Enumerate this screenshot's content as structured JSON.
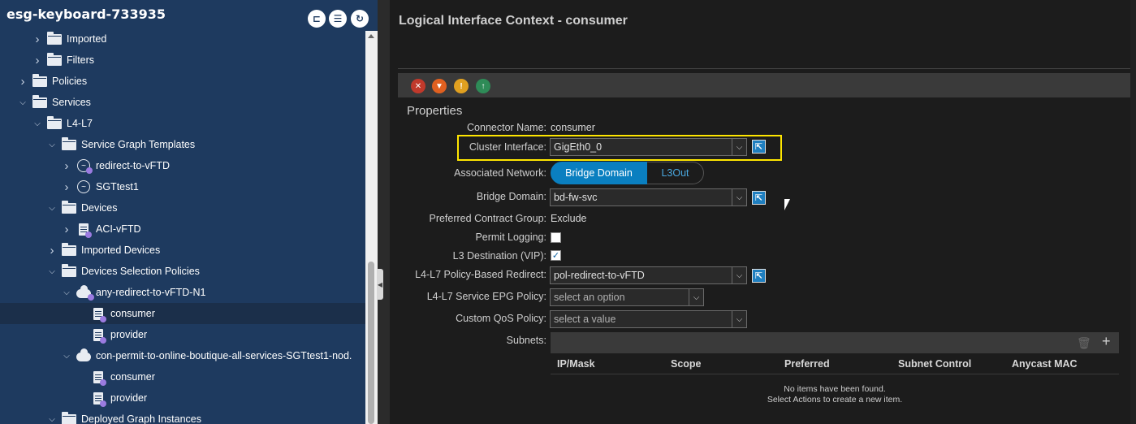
{
  "left_panel": {
    "title": "esg-keyboard-733935",
    "header_buttons": [
      "pin-icon",
      "collapse-list-icon",
      "refresh-icon"
    ],
    "tree": [
      {
        "label": "Imported",
        "level": 2,
        "icon": "folder-icon",
        "chevron": "right"
      },
      {
        "label": "Filters",
        "level": 2,
        "icon": "folder-icon",
        "chevron": "right"
      },
      {
        "label": "Policies",
        "level": 1,
        "icon": "folder-icon",
        "chevron": "right"
      },
      {
        "label": "Services",
        "level": 1,
        "icon": "folder-icon",
        "chevron": "down"
      },
      {
        "label": "L4-L7",
        "level": 2,
        "icon": "folder-icon",
        "chevron": "down"
      },
      {
        "label": "Service Graph Templates",
        "level": 3,
        "icon": "folder-icon",
        "chevron": "down"
      },
      {
        "label": "redirect-to-vFTD",
        "level": 4,
        "icon": "service-graph-icon",
        "chevron": "right"
      },
      {
        "label": "SGTtest1",
        "level": 4,
        "icon": "service-graph-icon",
        "chevron": "right"
      },
      {
        "label": "Devices",
        "level": 3,
        "icon": "folder-icon",
        "chevron": "down"
      },
      {
        "label": "ACI-vFTD",
        "level": 4,
        "icon": "device-icon",
        "chevron": "right"
      },
      {
        "label": "Imported Devices",
        "level": 3,
        "icon": "folder-icon",
        "chevron": "right"
      },
      {
        "label": "Devices Selection Policies",
        "level": 3,
        "icon": "folder-icon",
        "chevron": "down"
      },
      {
        "label": "any-redirect-to-vFTD-N1",
        "level": 4,
        "icon": "cloud-icon",
        "chevron": "down"
      },
      {
        "label": "consumer",
        "level": 5,
        "icon": "document-icon",
        "chevron": "",
        "selected": true
      },
      {
        "label": "provider",
        "level": 5,
        "icon": "document-icon",
        "chevron": ""
      },
      {
        "label": "con-permit-to-online-boutique-all-services-SGTtest1-nod.",
        "level": 4,
        "icon": "cloud-icon",
        "chevron": "down"
      },
      {
        "label": "consumer",
        "level": 5,
        "icon": "document-icon",
        "chevron": ""
      },
      {
        "label": "provider",
        "level": 5,
        "icon": "document-icon",
        "chevron": ""
      },
      {
        "label": "Deployed Graph Instances",
        "level": 3,
        "icon": "folder-icon",
        "chevron": "down"
      }
    ]
  },
  "right_panel": {
    "title": "Logical Interface Context - consumer",
    "toolbar_icons": [
      "fault-critical-icon",
      "fault-major-icon",
      "fault-warning-icon",
      "health-icon"
    ],
    "properties_heading": "Properties",
    "fields": {
      "connector_name": {
        "label": "Connector Name:",
        "value": "consumer"
      },
      "cluster_interface": {
        "label": "Cluster Interface:",
        "value": "GigEth0_0"
      },
      "associated_network": {
        "label": "Associated Network:",
        "options": [
          "Bridge Domain",
          "L3Out"
        ],
        "selected": "Bridge Domain"
      },
      "bridge_domain": {
        "label": "Bridge Domain:",
        "value": "bd-fw-svc"
      },
      "preferred_contract_group": {
        "label": "Preferred Contract Group:",
        "value": "Exclude"
      },
      "permit_logging": {
        "label": "Permit Logging:",
        "checked": false
      },
      "l3_destination": {
        "label": "L3 Destination (VIP):",
        "checked": true
      },
      "pbr": {
        "label": "L4-L7 Policy-Based Redirect:",
        "value": "pol-redirect-to-vFTD"
      },
      "service_epg_policy": {
        "label": "L4-L7 Service EPG Policy:",
        "placeholder": "select an option"
      },
      "custom_qos": {
        "label": "Custom QoS Policy:",
        "placeholder": "select a value"
      },
      "subnets": {
        "label": "Subnets:"
      }
    },
    "subnets_table": {
      "columns": [
        "IP/Mask",
        "Scope",
        "Preferred",
        "Subnet Control",
        "Anycast MAC"
      ],
      "empty_line1": "No items have been found.",
      "empty_line2": "Select Actions to create a new item."
    }
  },
  "colors": {
    "nav_bg": "#1e3a5f",
    "accent_blue": "#0a7fc0",
    "highlight": "#ffe600"
  }
}
